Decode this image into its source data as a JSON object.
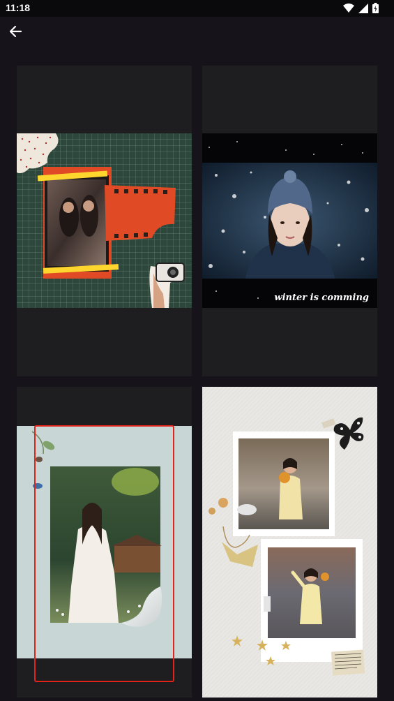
{
  "status_bar": {
    "time": "11:18",
    "icons": [
      "wifi-icon",
      "signal-icon",
      "battery-icon"
    ]
  },
  "toolbar": {
    "back_icon": "arrow-left-icon"
  },
  "templates": [
    {
      "id": "grid-scrapbook",
      "selected": false
    },
    {
      "id": "winter",
      "caption": "winter is comming",
      "selected": false
    },
    {
      "id": "page-curl",
      "selected": true
    },
    {
      "id": "polaroid-scrapbook",
      "selected": false
    }
  ],
  "colors": {
    "background": "#16141a",
    "card": "#1e1e20",
    "selection": "#e2231a"
  }
}
